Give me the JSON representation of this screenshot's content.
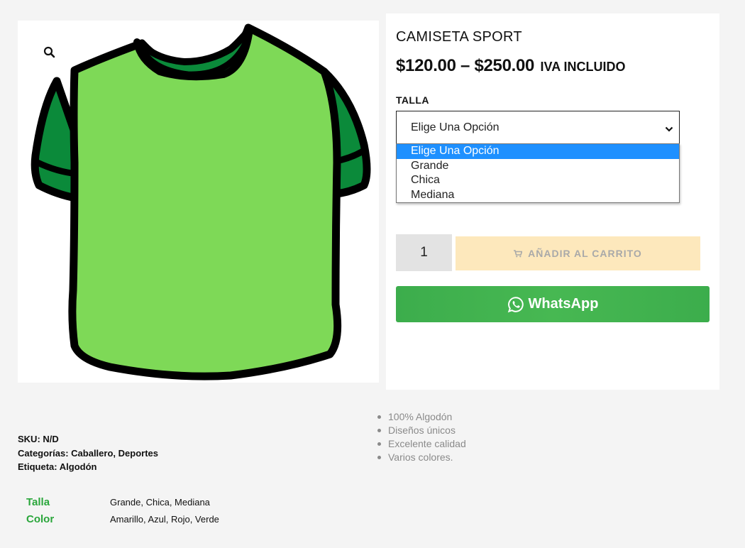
{
  "product": {
    "title": "CAMISETA SPORT",
    "price_range": "$120.00 – $250.00",
    "tax_note": "IVA INCLUIDO",
    "image_icon": "tshirt-image"
  },
  "variation": {
    "label": "TALLA",
    "selected": "Elige Una Opción",
    "options": [
      "Elige Una Opción",
      "Grande",
      "Chica",
      "Mediana"
    ]
  },
  "cart": {
    "quantity": "1",
    "add_label": "AÑADIR AL CARRITO",
    "add_icon": "cart-icon"
  },
  "whatsapp": {
    "label": "WhatsApp",
    "icon": "whatsapp-icon"
  },
  "meta": {
    "sku_label": "SKU:",
    "sku_value": "N/D",
    "categories_label": "Categorías:",
    "categories": [
      "Caballero",
      "Deportes"
    ],
    "tag_label": "Etiqueta:",
    "tags": [
      "Algodón"
    ]
  },
  "features": [
    "100% Algodón",
    "Diseños únicos",
    "Excelente calidad",
    "Varios colores."
  ],
  "attributes": [
    {
      "name": "Talla",
      "value": "Grande, Chica, Mediana"
    },
    {
      "name": "Color",
      "value": "Amarillo, Azul, Rojo, Verde"
    }
  ],
  "colors": {
    "shirt_body": "#7ed957",
    "shirt_trim": "#0b8a3a",
    "accent_green": "#2aa63b",
    "whatsapp_green": "#45b552",
    "cart_button_bg": "#fde8bc",
    "selected_option": "#1e90ff"
  }
}
